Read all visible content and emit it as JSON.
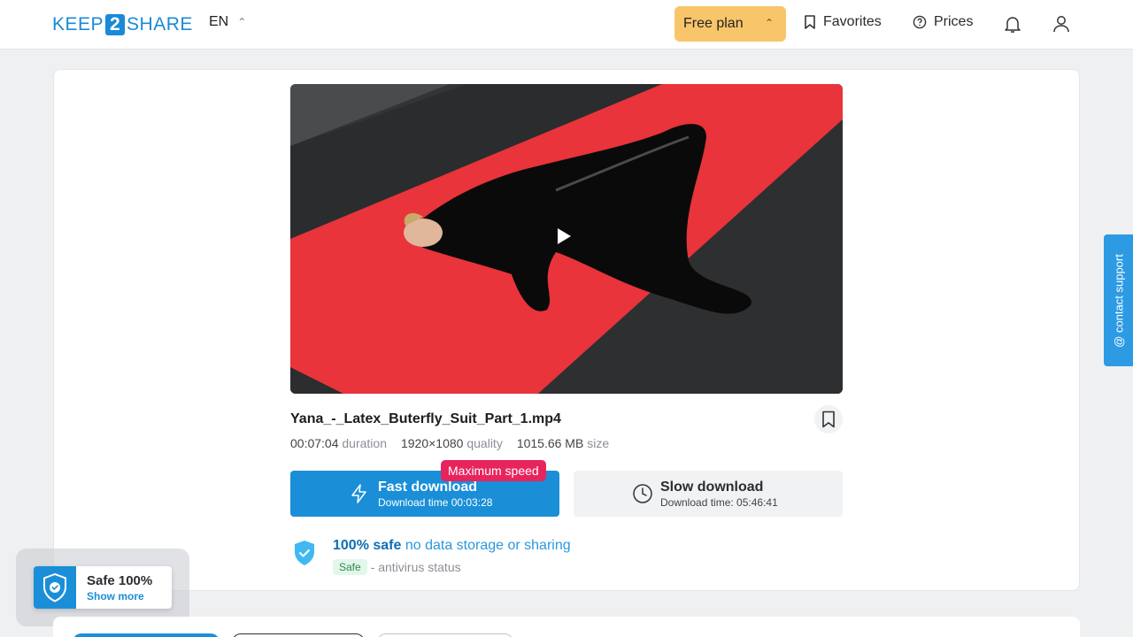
{
  "header": {
    "logo": {
      "left": "KEEP",
      "mid": "2",
      "right": "SHARE"
    },
    "language": "EN",
    "plan_label": "Free plan",
    "favorites_label": "Favorites",
    "prices_label": "Prices"
  },
  "file": {
    "name": "Yana_-_Latex_Buterfly_Suit_Part_1.mp4",
    "duration_value": "00:07:04",
    "duration_label": "duration",
    "quality_value": "1920×1080",
    "quality_label": "quality",
    "size_value": "1015.66 MB",
    "size_label": "size"
  },
  "downloads": {
    "badge": "Maximum speed",
    "fast_title": "Fast download",
    "fast_sub": "Download time 00:03:28",
    "slow_title": "Slow download",
    "slow_sub": "Download time: 05:46:41"
  },
  "safety": {
    "strong": "100% safe",
    "rest": "no data storage or sharing",
    "tag": "Safe",
    "status": "- antivirus status"
  },
  "contact_label": "@ contact support",
  "widget": {
    "title": "Safe 100%",
    "link": "Show more"
  },
  "colors": {
    "accent": "#1a8fd8",
    "plan": "#f9c56b",
    "badge": "#e8245d"
  }
}
